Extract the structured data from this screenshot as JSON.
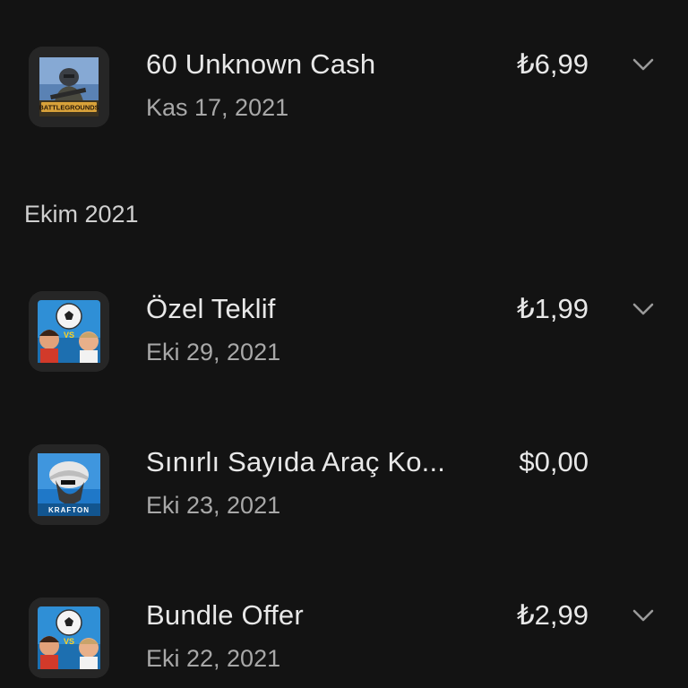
{
  "purchases": [
    {
      "title": "60 Unknown Cash",
      "date": "Kas 17, 2021",
      "price": "₺6,99",
      "app_icon": "pubg-battlegrounds-icon",
      "expandable": true
    },
    {
      "title": "Özel Teklif",
      "date": "Eki 29, 2021",
      "price": "₺1,99",
      "app_icon": "head-ball-icon",
      "expandable": true
    },
    {
      "title": "Sınırlı Sayıda Araç Ko...",
      "date": "Eki 23, 2021",
      "price": "$0,00",
      "app_icon": "krafton-icon",
      "expandable": false
    },
    {
      "title": "Bundle Offer",
      "date": "Eki 22, 2021",
      "price": "₺2,99",
      "app_icon": "head-ball-icon",
      "expandable": true
    }
  ],
  "sections": {
    "october": "Ekim 2021"
  },
  "icon_labels": {
    "pubg": "BATTLEGROUNDS",
    "krafton": "KRAFTON",
    "vs": "VS"
  },
  "colors": {
    "background": "#131313",
    "title_text": "#e8e8e8",
    "date_text": "#a8a8a8",
    "chevron": "#9a9a9a"
  }
}
